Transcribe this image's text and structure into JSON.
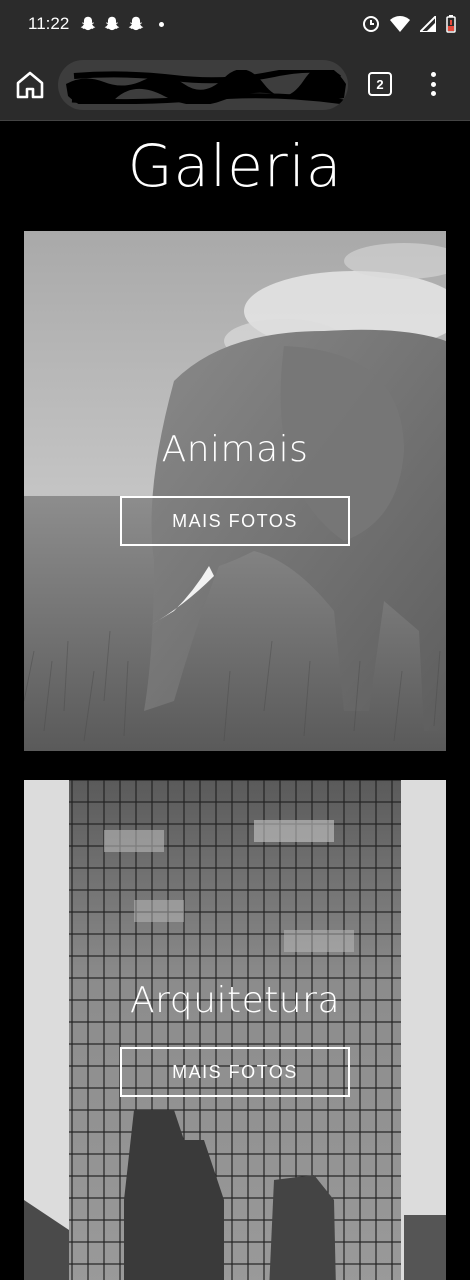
{
  "status_bar": {
    "time": "11:22",
    "notification_icons": [
      "snapchat-icon",
      "snapchat-icon",
      "snapchat-icon"
    ],
    "system_icons": [
      "alarm-icon",
      "wifi-icon",
      "signal-icon",
      "battery-low-icon"
    ]
  },
  "browser": {
    "tab_count": "2",
    "home_icon": "home-icon",
    "menu_icon": "more-vertical-icon"
  },
  "page": {
    "title": "Galeria"
  },
  "gallery": {
    "cards": [
      {
        "title": "Animais",
        "button_label": "MAIS FOTOS",
        "image": "elephant-photo"
      },
      {
        "title": "Arquitetura",
        "button_label": "MAIS FOTOS",
        "image": "skyscraper-photo"
      }
    ]
  },
  "colors": {
    "background": "#000000",
    "chrome": "#2b2b2b",
    "text": "#ffffff"
  }
}
